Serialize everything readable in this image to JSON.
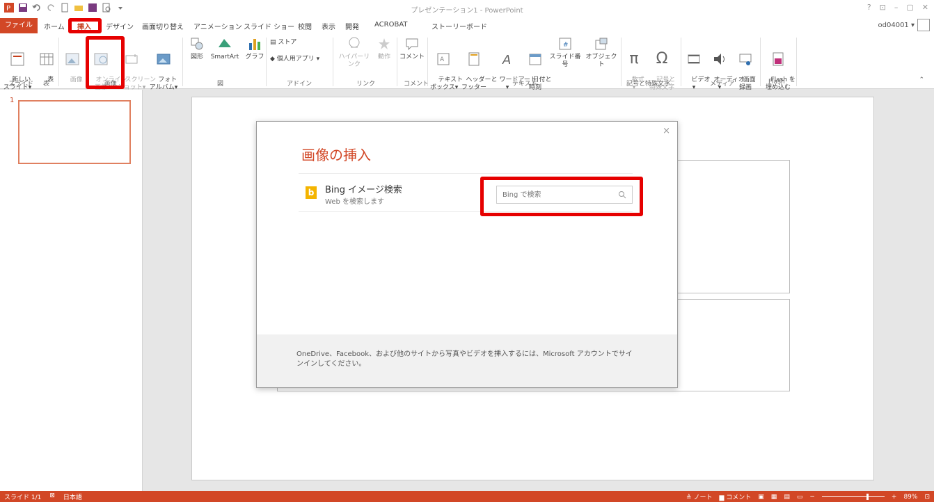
{
  "app": {
    "title": "プレゼンテーション1 - PowerPoint",
    "window_controls": [
      "?",
      "⊡",
      "–",
      "▢",
      "✕"
    ],
    "user": "od04001 ▾"
  },
  "tabs": {
    "file": "ファイル",
    "items": [
      "ホーム",
      "挿入",
      "デザイン",
      "画面切り替え",
      "アニメーション",
      "スライド ショー",
      "校閲",
      "表示",
      "開発",
      "ACROBAT",
      "ストーリーボード"
    ],
    "active": "挿入"
  },
  "ribbon": {
    "new_slide": "新しい\nスライド▾",
    "table": "表",
    "images": "画像",
    "online_images": "オンライン\n画像",
    "screenshot": "スクリーン\nショット▾",
    "photo_album": "フォト\nアルバム▾",
    "shapes": "図形",
    "smartart": "SmartArt",
    "chart": "グラフ",
    "store": "ストア",
    "my_apps": "個人用アプリ ▾",
    "hyperlink": "ハイパーリンク",
    "action": "動作",
    "comment": "コメント",
    "textbox": "テキスト\nボックス▾",
    "header_footer": "ヘッダーと\nフッター",
    "wordart": "ワードアート\n▾",
    "datetime": "日付と\n時刻",
    "slide_number": "スライド番号",
    "object": "オブジェクト",
    "equation": "数式\n▾",
    "symbol": "記号と\n特殊文字",
    "video": "ビデオ\n▾",
    "audio": "オーディオ\n▾",
    "screen_recording": "画面\n録画",
    "flash": "Flash を\n埋め込む",
    "groups": {
      "slides": "スライド",
      "tables": "表",
      "images": "画像",
      "illustrations": "図",
      "apps": "アドイン",
      "links": "リンク",
      "comments": "コメント",
      "text": "テキスト",
      "symbols": "記号と特殊文字",
      "media": "メディア",
      "flash": "Flash"
    }
  },
  "thumbs": {
    "number": "1"
  },
  "dialog": {
    "title": "画像の挿入",
    "close": "×",
    "bing_logo": "b",
    "bing_name": "Bing イメージ検索",
    "bing_sub": "Web を検索します",
    "search_placeholder": "Bing で検索",
    "footer": "OneDrive、Facebook、および他のサイトから写真やビデオを挿入するには、Microsoft アカウントでサインインしてください。"
  },
  "status": {
    "slide": "スライド 1/1",
    "lang": "日本語",
    "notes": "ノート",
    "comments": "コメント",
    "zoom": "89%"
  },
  "colors": {
    "accent": "#d24726",
    "highlight": "#e60000",
    "bing": "#f4b400"
  }
}
